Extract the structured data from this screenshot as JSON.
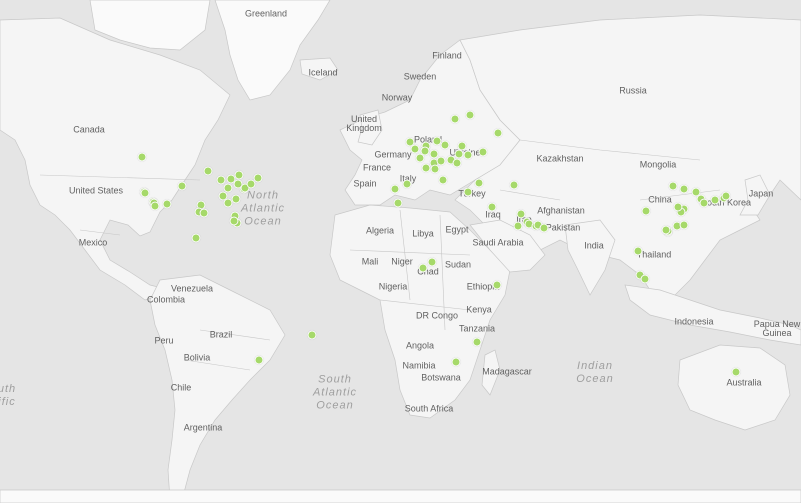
{
  "map": {
    "country_labels": [
      {
        "id": "greenland",
        "text": "Greenland"
      },
      {
        "id": "iceland",
        "text": "Iceland"
      },
      {
        "id": "finland",
        "text": "Finland"
      },
      {
        "id": "sweden",
        "text": "Sweden"
      },
      {
        "id": "norway",
        "text": "Norway"
      },
      {
        "id": "russia",
        "text": "Russia"
      },
      {
        "id": "canada",
        "text": "Canada"
      },
      {
        "id": "united-kingdom",
        "text": "United\nKingdom"
      },
      {
        "id": "poland",
        "text": "Poland"
      },
      {
        "id": "germany",
        "text": "Germany"
      },
      {
        "id": "ukraine",
        "text": "Ukraine"
      },
      {
        "id": "france",
        "text": "France"
      },
      {
        "id": "kazakhstan",
        "text": "Kazakhstan"
      },
      {
        "id": "mongolia",
        "text": "Mongolia"
      },
      {
        "id": "united-states",
        "text": "United States"
      },
      {
        "id": "spain",
        "text": "Spain"
      },
      {
        "id": "italy",
        "text": "Italy"
      },
      {
        "id": "turkey",
        "text": "Turkey"
      },
      {
        "id": "china",
        "text": "China"
      },
      {
        "id": "japan",
        "text": "Japan"
      },
      {
        "id": "south-korea",
        "text": "South Korea"
      },
      {
        "id": "iraq",
        "text": "Iraq"
      },
      {
        "id": "iran",
        "text": "Iran"
      },
      {
        "id": "afghanistan",
        "text": "Afghanistan"
      },
      {
        "id": "pakistan",
        "text": "Pakistan"
      },
      {
        "id": "mexico",
        "text": "Mexico"
      },
      {
        "id": "algeria",
        "text": "Algeria"
      },
      {
        "id": "libya",
        "text": "Libya"
      },
      {
        "id": "egypt",
        "text": "Egypt"
      },
      {
        "id": "saudi-arabia",
        "text": "Saudi Arabia"
      },
      {
        "id": "india",
        "text": "India"
      },
      {
        "id": "mali",
        "text": "Mali"
      },
      {
        "id": "niger",
        "text": "Niger"
      },
      {
        "id": "sudan",
        "text": "Sudan"
      },
      {
        "id": "chad",
        "text": "Chad"
      },
      {
        "id": "thailand",
        "text": "Thailand"
      },
      {
        "id": "venezuela",
        "text": "Venezuela"
      },
      {
        "id": "colombia",
        "text": "Colombia"
      },
      {
        "id": "nigeria",
        "text": "Nigeria"
      },
      {
        "id": "ethiopia",
        "text": "Ethiopia"
      },
      {
        "id": "dr-congo",
        "text": "DR Congo"
      },
      {
        "id": "kenya",
        "text": "Kenya"
      },
      {
        "id": "tanzania",
        "text": "Tanzania"
      },
      {
        "id": "indonesia",
        "text": "Indonesia"
      },
      {
        "id": "papua-new-guinea",
        "text": "Papua New\nGuinea"
      },
      {
        "id": "brazil",
        "text": "Brazil"
      },
      {
        "id": "peru",
        "text": "Peru"
      },
      {
        "id": "bolivia",
        "text": "Bolivia"
      },
      {
        "id": "angola",
        "text": "Angola"
      },
      {
        "id": "namibia",
        "text": "Namibia"
      },
      {
        "id": "botswana",
        "text": "Botswana"
      },
      {
        "id": "madagascar",
        "text": "Madagascar"
      },
      {
        "id": "australia",
        "text": "Australia"
      },
      {
        "id": "chile",
        "text": "Chile"
      },
      {
        "id": "south-africa",
        "text": "South Africa"
      },
      {
        "id": "argentina",
        "text": "Argentina"
      }
    ],
    "ocean_labels": [
      {
        "id": "north-atlantic",
        "text": "North\nAtlantic\nOcean"
      },
      {
        "id": "south-atlantic",
        "text": "South\nAtlantic\nOcean"
      },
      {
        "id": "indian-ocean",
        "text": "Indian\nOcean"
      },
      {
        "id": "south-pacific-partial",
        "text": "uth\nific"
      }
    ],
    "marker_color": "#a6d96a",
    "land_color": "#f5f5f5",
    "water_color": "#e5e5e5",
    "markers": [
      {
        "lat": 49.3,
        "lon": -123.1
      },
      {
        "lat": 37.8,
        "lon": -122.4
      },
      {
        "lat": 37.3,
        "lon": -121.9
      },
      {
        "lat": 34.1,
        "lon": -118.2
      },
      {
        "lat": 33.7,
        "lon": -117.8
      },
      {
        "lat": 32.7,
        "lon": -117.2
      },
      {
        "lat": 33.4,
        "lon": -112.1
      },
      {
        "lat": 39.7,
        "lon": -105.0
      },
      {
        "lat": 32.8,
        "lon": -96.8
      },
      {
        "lat": 30.3,
        "lon": -97.7
      },
      {
        "lat": 29.8,
        "lon": -95.4
      },
      {
        "lat": 44.9,
        "lon": -93.3
      },
      {
        "lat": 41.9,
        "lon": -87.6
      },
      {
        "lat": 36.2,
        "lon": -86.8
      },
      {
        "lat": 33.7,
        "lon": -84.4
      },
      {
        "lat": 42.3,
        "lon": -83.0
      },
      {
        "lat": 39.1,
        "lon": -84.5
      },
      {
        "lat": 43.7,
        "lon": -79.4
      },
      {
        "lat": 40.4,
        "lon": -80.0
      },
      {
        "lat": 38.9,
        "lon": -77.0
      },
      {
        "lat": 39.3,
        "lon": -76.6
      },
      {
        "lat": 40.7,
        "lon": -74.0
      },
      {
        "lat": 42.4,
        "lon": -71.1
      },
      {
        "lat": 35.2,
        "lon": -80.8
      },
      {
        "lat": 28.5,
        "lon": -81.4
      },
      {
        "lat": 25.8,
        "lon": -80.2
      },
      {
        "lat": 26.6,
        "lon": -81.9
      },
      {
        "lat": 19.4,
        "lon": -99.1
      },
      {
        "lat": -23.5,
        "lon": -46.6
      },
      {
        "lat": -33.4,
        "lon": -70.6
      },
      {
        "lat": 53.4,
        "lon": -2.2
      },
      {
        "lat": 51.5,
        "lon": -0.1
      },
      {
        "lat": 51.9,
        "lon": 4.5
      },
      {
        "lat": 52.4,
        "lon": 4.9
      },
      {
        "lat": 50.8,
        "lon": 4.4
      },
      {
        "lat": 48.9,
        "lon": 2.4
      },
      {
        "lat": 45.8,
        "lon": 4.8
      },
      {
        "lat": 47.4,
        "lon": 8.5
      },
      {
        "lat": 50.1,
        "lon": 8.7
      },
      {
        "lat": 48.1,
        "lon": 11.6
      },
      {
        "lat": 52.5,
        "lon": 13.4
      },
      {
        "lat": 53.6,
        "lon": 10.0
      },
      {
        "lat": 52.2,
        "lon": 21.0
      },
      {
        "lat": 50.1,
        "lon": 19.9
      },
      {
        "lat": 48.2,
        "lon": 16.4
      },
      {
        "lat": 47.5,
        "lon": 19.0
      },
      {
        "lat": 45.5,
        "lon": 9.2
      },
      {
        "lat": 41.9,
        "lon": 12.5
      },
      {
        "lat": 59.3,
        "lon": 18.1
      },
      {
        "lat": 60.2,
        "lon": 24.9
      },
      {
        "lat": 55.8,
        "lon": 37.6
      },
      {
        "lat": 50.5,
        "lon": 30.5
      },
      {
        "lat": 49.8,
        "lon": 24.0
      },
      {
        "lat": 41.0,
        "lon": 29.0
      },
      {
        "lat": 40.4,
        "lon": -3.7
      },
      {
        "lat": 38.7,
        "lon": -9.1
      },
      {
        "lat": 37.9,
        "lon": 23.7
      },
      {
        "lat": 33.6,
        "lon": -7.6
      },
      {
        "lat": 32.1,
        "lon": 34.8
      },
      {
        "lat": 40.2,
        "lon": 44.5
      },
      {
        "lat": 24.7,
        "lon": 46.7
      },
      {
        "lat": 29.4,
        "lon": 48.0
      },
      {
        "lat": 26.2,
        "lon": 50.6
      },
      {
        "lat": 25.3,
        "lon": 51.5
      },
      {
        "lat": 24.5,
        "lon": 54.4
      },
      {
        "lat": 25.2,
        "lon": 55.3
      },
      {
        "lat": 23.6,
        "lon": 58.4
      },
      {
        "lat": 6.5,
        "lon": 3.4
      },
      {
        "lat": 9.1,
        "lon": 7.5
      },
      {
        "lat": -1.3,
        "lon": 36.8
      },
      {
        "lat": -26.2,
        "lon": 28.0
      },
      {
        "lat": -33.9,
        "lon": 18.4
      },
      {
        "lat": 13.8,
        "lon": 100.5
      },
      {
        "lat": 3.1,
        "lon": 101.7
      },
      {
        "lat": 1.3,
        "lon": 103.8
      },
      {
        "lat": 22.3,
        "lon": 114.2
      },
      {
        "lat": 22.5,
        "lon": 114.1
      },
      {
        "lat": 23.1,
        "lon": 113.3
      },
      {
        "lat": 24.5,
        "lon": 118.1
      },
      {
        "lat": 25.0,
        "lon": 121.5
      },
      {
        "lat": 31.2,
        "lon": 121.5
      },
      {
        "lat": 30.3,
        "lon": 120.2
      },
      {
        "lat": 32.1,
        "lon": 118.8
      },
      {
        "lat": 30.6,
        "lon": 104.1
      },
      {
        "lat": 39.9,
        "lon": 116.4
      },
      {
        "lat": 38.9,
        "lon": 121.6
      },
      {
        "lat": 37.6,
        "lon": 127.0
      },
      {
        "lat": 35.2,
        "lon": 129.0
      },
      {
        "lat": 34.7,
        "lon": 135.5
      },
      {
        "lat": 35.7,
        "lon": 139.7
      },
      {
        "lat": 36.4,
        "lon": 140.5
      },
      {
        "lat": 33.6,
        "lon": 130.4
      },
      {
        "lat": -37.8,
        "lon": 145.0
      }
    ]
  }
}
